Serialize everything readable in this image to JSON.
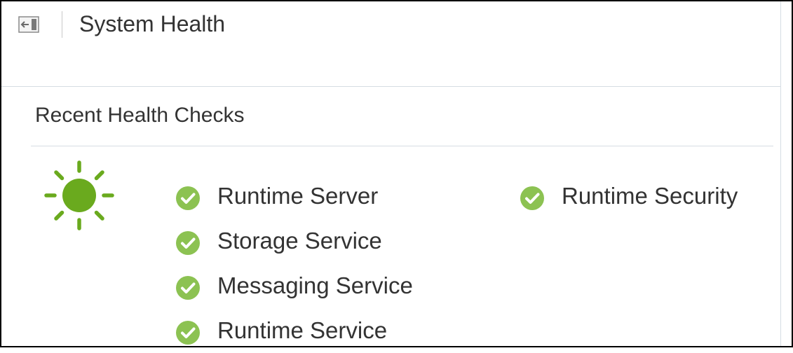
{
  "header": {
    "title": "System Health",
    "collapse_icon": "panel-collapse-icon"
  },
  "panel": {
    "title": "Recent Health Checks",
    "status_icon": "sun-icon",
    "status_color": "#6aaa1e",
    "check_color": "#8cc252",
    "columns": [
      {
        "items": [
          {
            "label": "Runtime Server",
            "status": "ok"
          },
          {
            "label": "Storage Service",
            "status": "ok"
          },
          {
            "label": "Messaging Service",
            "status": "ok"
          },
          {
            "label": "Runtime Service",
            "status": "ok"
          }
        ]
      },
      {
        "items": [
          {
            "label": "Runtime Security",
            "status": "ok"
          }
        ]
      }
    ]
  }
}
